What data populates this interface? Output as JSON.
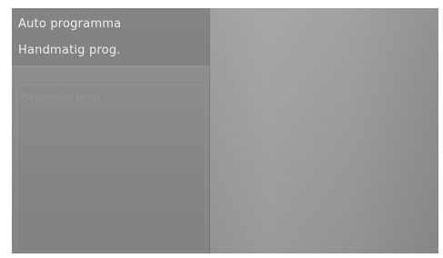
{
  "menu": {
    "items": [
      {
        "label": "Auto programma"
      },
      {
        "label": "Handmatig prog."
      }
    ],
    "disabled_items": [
      {
        "label": "Favoriete prog."
      }
    ]
  },
  "colors": {
    "screen_bg": "#9a9a9a",
    "menu_bg": "#7d7d7d",
    "text": "#eeeeee",
    "disabled_text": "#929292"
  }
}
